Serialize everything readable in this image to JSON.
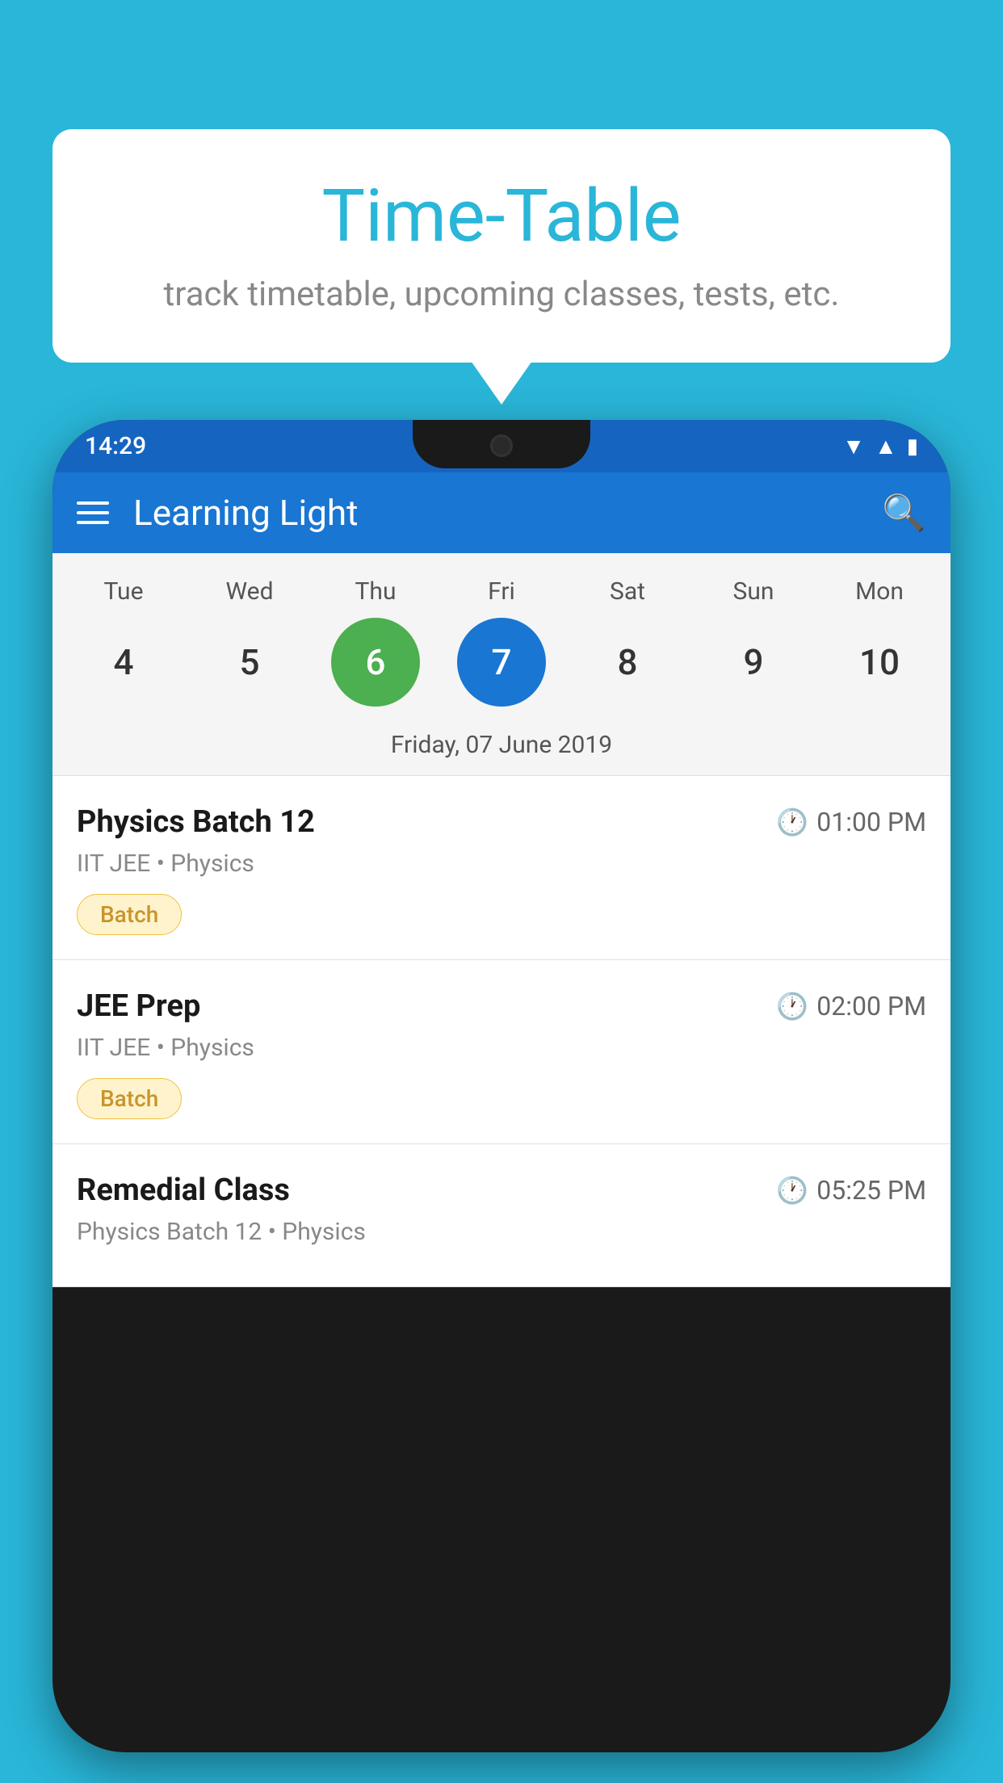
{
  "background_color": "#29B6D8",
  "bubble": {
    "title": "Time-Table",
    "subtitle": "track timetable, upcoming classes, tests, etc."
  },
  "app_bar": {
    "title": "Learning Light"
  },
  "status_bar": {
    "time": "14:29"
  },
  "calendar": {
    "days": [
      "Tue",
      "Wed",
      "Thu",
      "Fri",
      "Sat",
      "Sun",
      "Mon"
    ],
    "dates": [
      "4",
      "5",
      "6",
      "7",
      "8",
      "9",
      "10"
    ],
    "today_index": 2,
    "selected_index": 3,
    "selected_label": "Friday, 07 June 2019"
  },
  "schedule": [
    {
      "title": "Physics Batch 12",
      "time": "01:00 PM",
      "subtitle": "IIT JEE • Physics",
      "tag": "Batch"
    },
    {
      "title": "JEE Prep",
      "time": "02:00 PM",
      "subtitle": "IIT JEE • Physics",
      "tag": "Batch"
    },
    {
      "title": "Remedial Class",
      "time": "05:25 PM",
      "subtitle": "Physics Batch 12 • Physics",
      "tag": ""
    }
  ]
}
